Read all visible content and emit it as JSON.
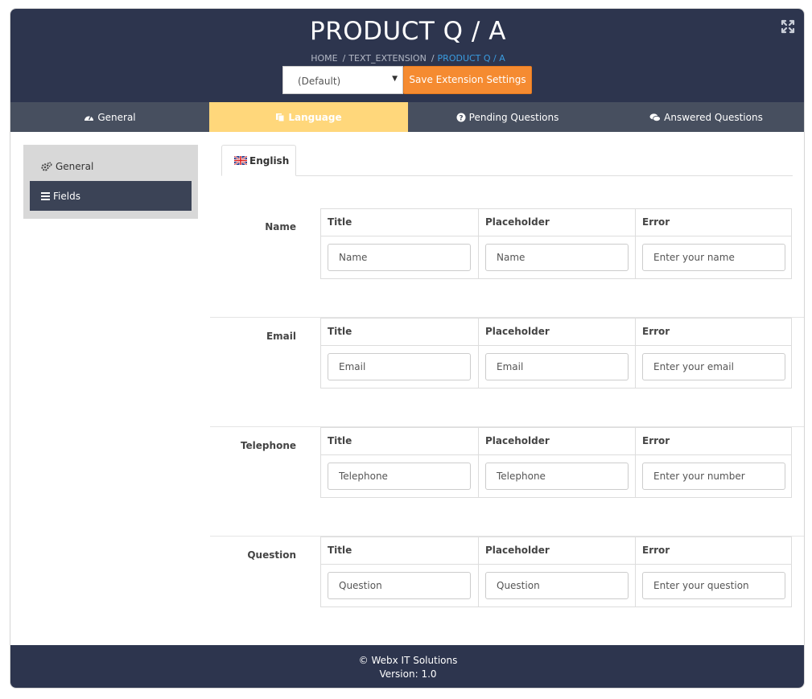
{
  "header": {
    "title": "PRODUCT Q / A",
    "breadcrumb": [
      "HOME",
      "TEXT_EXTENSION",
      "PRODUCT Q / A"
    ],
    "store_select": "(Default)",
    "save_label": "Save Extension Settings"
  },
  "tabs": [
    {
      "label": "General",
      "icon": "dashboard-icon"
    },
    {
      "label": "Language",
      "icon": "language-icon"
    },
    {
      "label": "Pending Questions",
      "icon": "question-circle-icon"
    },
    {
      "label": "Answered Questions",
      "icon": "comments-icon"
    }
  ],
  "sidebar": {
    "items": [
      {
        "label": "General",
        "icon": "cogs-icon"
      },
      {
        "label": "Fields",
        "icon": "bars-icon"
      }
    ]
  },
  "language_tab": {
    "label": "English",
    "icon": "uk-flag-icon"
  },
  "columns": [
    "Title",
    "Placeholder",
    "Error"
  ],
  "fields": [
    {
      "label": "Name",
      "title": "Name",
      "placeholder": "Name",
      "error": "Enter your name"
    },
    {
      "label": "Email",
      "title": "Email",
      "placeholder": "Email",
      "error": "Enter your email"
    },
    {
      "label": "Telephone",
      "title": "Telephone",
      "placeholder": "Telephone",
      "error": "Enter your number"
    },
    {
      "label": "Question",
      "title": "Question",
      "placeholder": "Question",
      "error": "Enter your question"
    }
  ],
  "footer": {
    "copyright": "© Webx IT Solutions",
    "version": "Version: 1.0"
  },
  "colors": {
    "header_bg": "#2d354e",
    "tab_bar": "#474f5f",
    "active_tab": "#ffd77b",
    "save_button": "#f58b31",
    "breadcrumb_active": "#3a9ce0"
  }
}
